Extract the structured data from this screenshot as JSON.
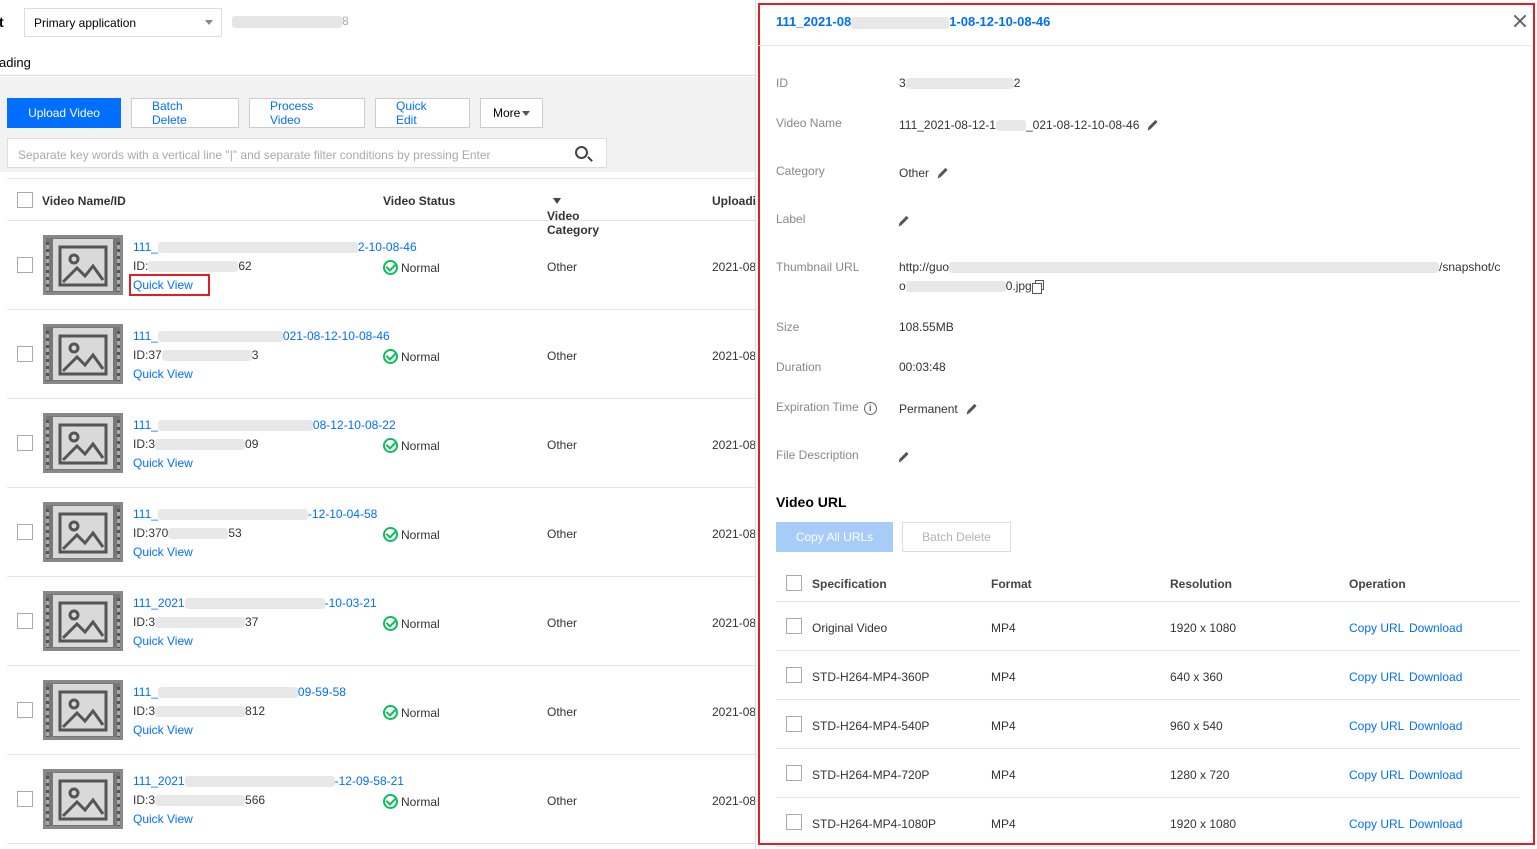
{
  "header": {
    "title_glyph": "t",
    "app_select": "Primary application",
    "app_id_tail": "8",
    "tab": "ading"
  },
  "toolbar": {
    "upload": "Upload Video",
    "batch_delete": "Batch Delete",
    "process": "Process Video",
    "quick_edit": "Quick Edit",
    "more": "More"
  },
  "search": {
    "placeholder": "Separate key words with a vertical line \"|\" and separate filter conditions by pressing Enter"
  },
  "table": {
    "columns": [
      "Video Name/ID",
      "Video Status",
      "Video Category",
      "Uploadi"
    ],
    "quick_view": "Quick View",
    "rows": [
      {
        "name_pre": "111_",
        "name_post": "2-10-08-46",
        "id_pre": "ID:",
        "id_post": "62",
        "status": "Normal",
        "category": "Other",
        "time": "2021-08"
      },
      {
        "name_pre": "111_",
        "name_post": "021-08-12-10-08-46",
        "id_pre": "ID:37",
        "id_post": "3",
        "status": "Normal",
        "category": "Other",
        "time": "2021-08"
      },
      {
        "name_pre": "111_",
        "name_post": "08-12-10-08-22",
        "id_pre": "ID:3",
        "id_post": "09",
        "status": "Normal",
        "category": "Other",
        "time": "2021-08"
      },
      {
        "name_pre": "111_",
        "name_post": "-12-10-04-58",
        "id_pre": "ID:370",
        "id_post": "53",
        "status": "Normal",
        "category": "Other",
        "time": "2021-08"
      },
      {
        "name_pre": "111_2021",
        "name_post": "-10-03-21",
        "id_pre": "ID:3",
        "id_post": "37",
        "status": "Normal",
        "category": "Other",
        "time": "2021-08"
      },
      {
        "name_pre": "111_",
        "name_post": "09-59-58",
        "id_pre": "ID:3",
        "id_post": "812",
        "status": "Normal",
        "category": "Other",
        "time": "2021-08"
      },
      {
        "name_pre": "111_2021",
        "name_post": "-12-09-58-21",
        "id_pre": "ID:3",
        "id_post": "566",
        "status": "Normal",
        "category": "Other",
        "time": "2021-08"
      }
    ]
  },
  "drawer": {
    "title_pre": "111_2021-08",
    "title_post": "1-08-12-10-08-46",
    "fields": {
      "id_label": "ID",
      "id_pre": "3",
      "id_post": "2",
      "name_label": "Video Name",
      "name_pre": "111_2021-08-12-1",
      "name_post": "_021-08-12-10-08-46",
      "category_label": "Category",
      "category_value": "Other",
      "label_label": "Label",
      "thumb_label": "Thumbnail URL",
      "thumb_line1_pre": "http://guo",
      "thumb_line1_post": "/snapshot/c",
      "thumb_line2_pre": "o",
      "thumb_line2_post": "0.jpg",
      "size_label": "Size",
      "size_value": "108.55MB",
      "duration_label": "Duration",
      "duration_value": "00:03:48",
      "expiration_label": "Expiration Time",
      "expiration_value": "Permanent",
      "desc_label": "File Description"
    },
    "video_url": {
      "heading": "Video URL",
      "copy_all": "Copy All URLs",
      "batch_delete": "Batch Delete",
      "columns": [
        "Specification",
        "Format",
        "Resolution",
        "Operation"
      ],
      "copy_label": "Copy URL",
      "download_label": "Download",
      "rows": [
        {
          "spec": "Original Video",
          "format": "MP4",
          "res": "1920 x 1080"
        },
        {
          "spec": "STD-H264-MP4-360P",
          "format": "MP4",
          "res": "640 x 360"
        },
        {
          "spec": "STD-H264-MP4-540P",
          "format": "MP4",
          "res": "960 x 540"
        },
        {
          "spec": "STD-H264-MP4-720P",
          "format": "MP4",
          "res": "1280 x 720"
        },
        {
          "spec": "STD-H264-MP4-1080P",
          "format": "MP4",
          "res": "1920 x 1080"
        }
      ]
    }
  },
  "colors": {
    "accent": "#006eff",
    "success": "#0abf5b",
    "highlight": "#e02020"
  }
}
